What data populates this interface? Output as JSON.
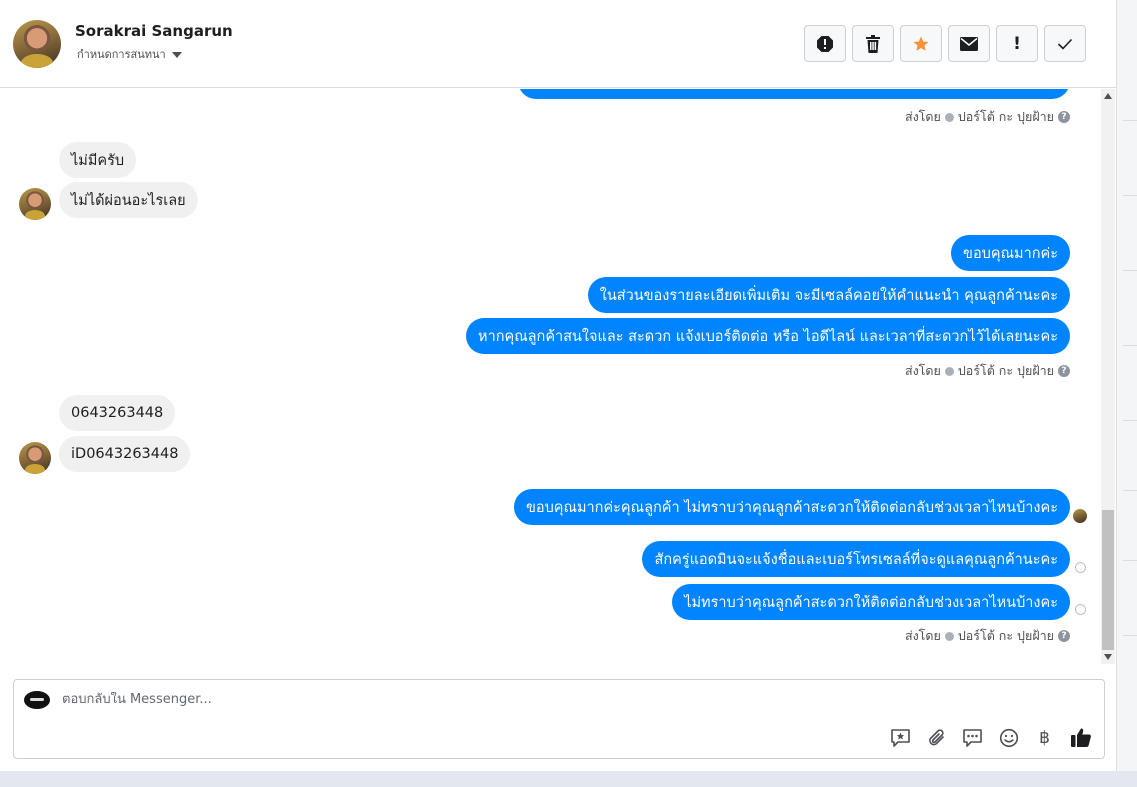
{
  "header": {
    "contact_name": "Sorakrai Sangarun",
    "status_label": "กำหนดการสนทนา"
  },
  "toolbar": {
    "buttons": [
      "report-icon",
      "trash-icon",
      "star-icon",
      "envelope-icon",
      "exclamation-icon",
      "check-icon"
    ],
    "star_color": "#f7923a",
    "exclamation_label": "!"
  },
  "messages": {
    "sent_by_label": "ส่งโดย",
    "sender_name": "ปอร์โต้ กะ ปุยฝ้าย",
    "help_label": "?",
    "customer_group1": [
      "ไม่มีครับ",
      "ไม่ได้ผ่อนอะไรเลย"
    ],
    "page_group1": [
      "ขอบคุณมากค่ะ",
      "ในส่วนของรายละเอียดเพิ่มเติม จะมีเซลล์คอยให้คำแนะนำ คุณลูกค้านะคะ",
      "หากคุณลูกค้าสนใจและ สะดวก แจ้งเบอร์ติดต่อ หรือ ไอดีไลน์ และเวลาที่สะดวกไว้ได้เลยนะคะ"
    ],
    "customer_group2": [
      "0643263448",
      "iD0643263448"
    ],
    "page_group2": [
      "ขอบคุณมากค่ะคุณลูกค้า ไม่ทราบว่าคุณลูกค้าสะดวกให้ติดต่อกลับช่วงเวลาไหนบ้างคะ",
      "สักครู่แอดมินจะแจ้งชื่อและเบอร์โทรเซลล์ที่จะดูแลคุณลูกค้านะคะ",
      "ไม่ทราบว่าคุณลูกค้าสะดวกให้ติดต่อกลับช่วงเวลาไหนบ้างคะ"
    ]
  },
  "composer": {
    "placeholder": "ตอบกลับใน Messenger...",
    "tools": [
      "saved-reply-icon",
      "attachment-icon",
      "chat-bubbles-icon",
      "emoji-icon",
      "baht-icon",
      "like-icon"
    ],
    "baht_symbol": "฿"
  },
  "colors": {
    "outgoing_bubble": "#0084ff",
    "incoming_bubble": "#f0f0f0"
  }
}
